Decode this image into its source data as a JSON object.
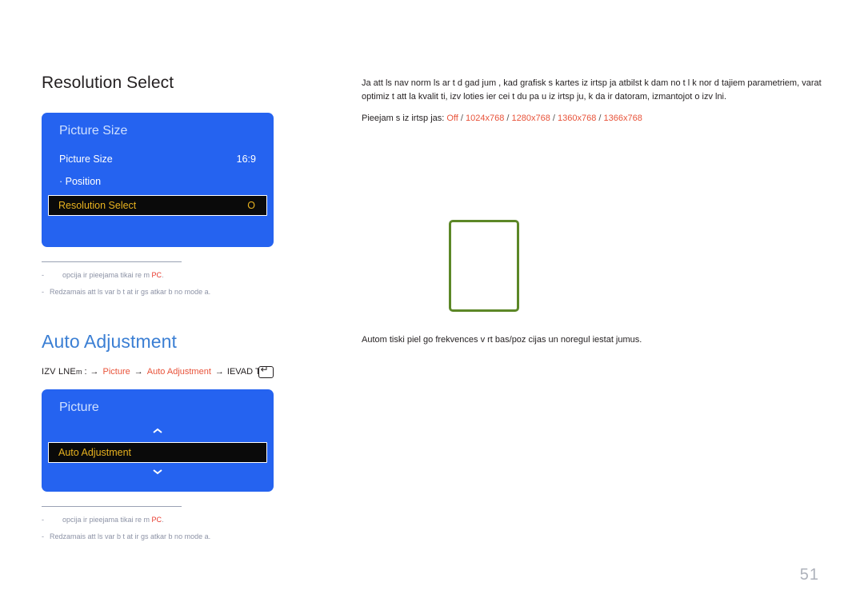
{
  "page": {
    "number": "51"
  },
  "sections": [
    {
      "heading": "Resolution Select",
      "heading_color": "#231f20",
      "osd": {
        "title": "Picture Size",
        "rows": [
          {
            "label": "Picture Size",
            "value": "16:9",
            "selected": false
          },
          {
            "label": "· Position",
            "value": "",
            "selected": false
          },
          {
            "label": "Resolution Select",
            "value": "O",
            "selected": true
          }
        ]
      },
      "footnotes": [
        {
          "dash": "-",
          "text": "opcija ir pieejama tikai re m ",
          "accent": "PC",
          "suffix": ".",
          "indent": true
        },
        {
          "dash": "-",
          "text": "Redzamais att ls var b t at  ir gs atkar b  no mode a.",
          "accent": "",
          "suffix": "",
          "indent": false
        }
      ]
    },
    {
      "heading": "Auto Adjustment",
      "heading_color": "#3b7fd4",
      "path": {
        "prefix": "IZV LNE",
        "prefix_tiny": "m",
        "colon": ":",
        "crumbs": [
          "Picture",
          "Auto Adjustment"
        ],
        "arrow": "→",
        "suffix": "IEVAD T",
        "key_icon": "enter-key-icon"
      },
      "osd": {
        "title": "Picture",
        "chevron_up": "chevron-up-icon",
        "chevron_down": "chevron-down-icon",
        "rows": [
          {
            "label": "Auto Adjustment",
            "value": "",
            "selected": true
          }
        ]
      },
      "footnotes": [
        {
          "dash": "-",
          "text": "opcija ir pieejama tikai re m ",
          "accent": "PC",
          "suffix": ".",
          "indent": true
        },
        {
          "dash": "-",
          "text": "Redzamais att ls var b t at  ir gs atkar b  no mode a.",
          "accent": "",
          "suffix": "",
          "indent": false
        }
      ]
    }
  ],
  "right": {
    "paragraph_line1": "Ja att ls nav norm ls ar  t d  gad jum , kad grafisk s kartes iz irtsp ja atbilst k dam no t l k nor d tajiem parametriem, varat",
    "paragraph_line2": "optimiz t att la kvalit ti, izv loties ier cei t du pa u iz irtsp ju, k da ir datoram, izmantojot  o izv lni.",
    "available_label": "Pieejam s iz irtsp jas: ",
    "available_options": [
      "Off",
      "1024x768",
      "1280x768",
      "1360x768",
      "1366x768"
    ],
    "available_separator": " / ",
    "caption": "Autom tiski piel go frekvences v rt bas/poz cijas un noregul  iestat jumus."
  },
  "colors": {
    "osd_blue": "#2563f0",
    "osd_title": "#cfe0ff",
    "selected_bg": "#0a0a0a",
    "selected_text": "#e8b21f",
    "heading_blue": "#3b7fd4",
    "accent_red": "#e8392d",
    "crumb_orange": "#e8533a",
    "green_border": "#5c8727",
    "footnote_gray": "#8d93a6",
    "page_gray": "#aeb2bb"
  }
}
